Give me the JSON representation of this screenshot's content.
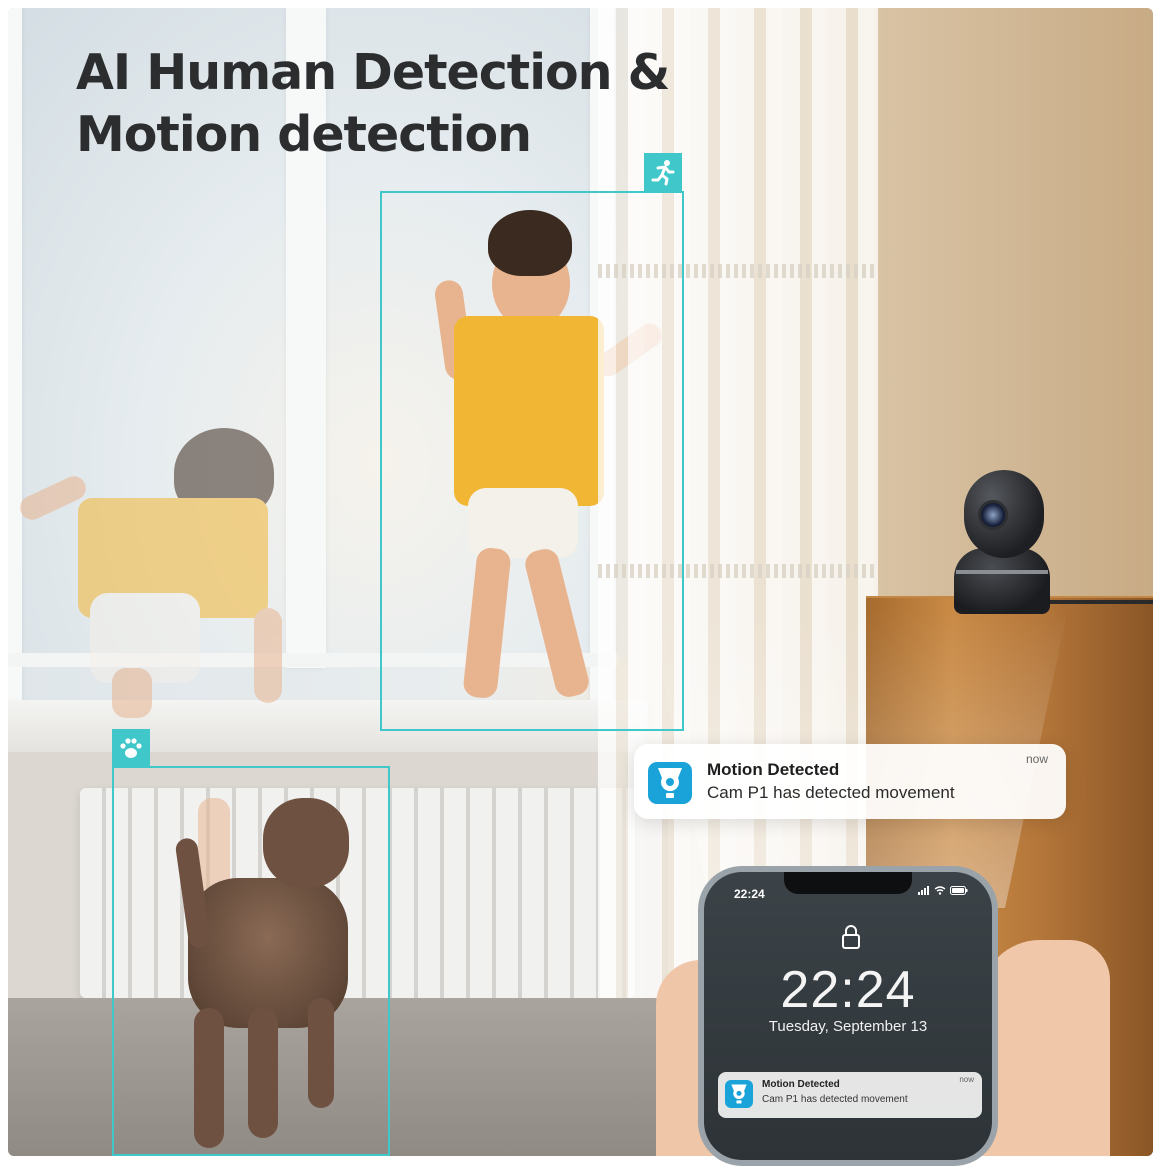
{
  "headline": {
    "line1": "AI Human Detection &",
    "line2": "Motion detection"
  },
  "detections": [
    {
      "label_icon": "running-person-icon",
      "target": "child"
    },
    {
      "label_icon": "paw-icon",
      "target": "dog"
    }
  ],
  "notification": {
    "title": "Motion Detected",
    "body": "Cam P1 has detected movement",
    "time": "now",
    "icon": "camera-app-icon"
  },
  "phone": {
    "status_time": "22:24",
    "clock": "22:24",
    "date": "Tuesday, September 13",
    "notification": {
      "title": "Motion Detected",
      "body": "Cam P1 has detected movement",
      "time": "now"
    }
  },
  "colors": {
    "accent": "#3fc7c9",
    "app_icon": "#1aa3d9",
    "headline": "#2c2d2f"
  }
}
